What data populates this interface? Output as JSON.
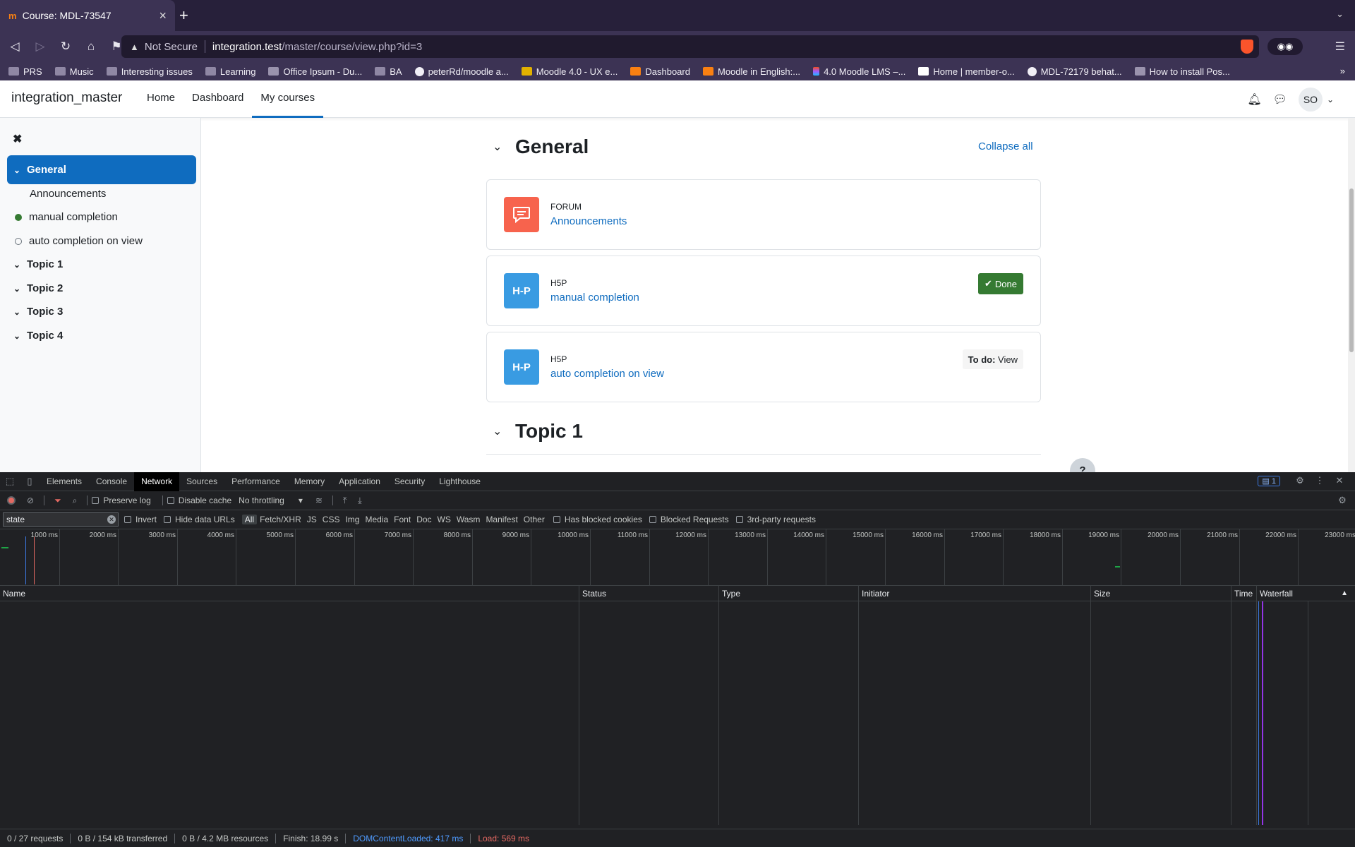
{
  "browser": {
    "tab_title": "Course: MDL-73547",
    "tab_favicon": "m",
    "url_warning": "Not Secure",
    "url_host": "integration.test",
    "url_path": "/master/course/view.php?id=3",
    "bookmarks": [
      {
        "label": "PRS",
        "icon": "folder"
      },
      {
        "label": "Music",
        "icon": "folder"
      },
      {
        "label": "Interesting issues",
        "icon": "folder"
      },
      {
        "label": "Learning",
        "icon": "folder"
      },
      {
        "label": "Office Ipsum - Du...",
        "icon": "page"
      },
      {
        "label": "BA",
        "icon": "folder"
      },
      {
        "label": "peterRd/moodle a...",
        "icon": "github"
      },
      {
        "label": "Moodle 4.0 - UX e...",
        "icon": "mustard"
      },
      {
        "label": "Dashboard",
        "icon": "moodle"
      },
      {
        "label": "Moodle in English:...",
        "icon": "moodle"
      },
      {
        "label": "4.0 Moodle LMS –...",
        "icon": "figma"
      },
      {
        "label": "Home | member-o...",
        "icon": "wix"
      },
      {
        "label": "MDL-72179 behat...",
        "icon": "github"
      },
      {
        "label": "How to install Pos...",
        "icon": "page"
      }
    ],
    "bookmarks_more": "»"
  },
  "moodle": {
    "site_name": "integration_master",
    "primary_nav": [
      {
        "label": "Home",
        "active": false
      },
      {
        "label": "Dashboard",
        "active": false
      },
      {
        "label": "My courses",
        "active": true
      }
    ],
    "user_initials": "SO",
    "course_index": [
      {
        "label": "General",
        "kind": "section",
        "active": true
      },
      {
        "label": "Announcements",
        "kind": "activity-plain"
      },
      {
        "label": "manual completion",
        "kind": "activity-done"
      },
      {
        "label": "auto completion on view",
        "kind": "activity-todo"
      },
      {
        "label": "Topic 1",
        "kind": "section"
      },
      {
        "label": "Topic 2",
        "kind": "section"
      },
      {
        "label": "Topic 3",
        "kind": "section"
      },
      {
        "label": "Topic 4",
        "kind": "section"
      }
    ],
    "section_general_title": "General",
    "collapse_all": "Collapse all",
    "activities": [
      {
        "type": "FORUM",
        "name": "Announcements",
        "icon": "forum-icon",
        "icon_color": "#f7634d"
      },
      {
        "type": "H5P",
        "name": "manual completion",
        "icon": "h5p-icon",
        "icon_color": "#399be2",
        "completion": "Done"
      },
      {
        "type": "H5P",
        "name": "auto completion on view",
        "icon": "h5p-icon",
        "icon_color": "#399be2",
        "todo_prefix": "To do:",
        "todo_value": "View"
      }
    ],
    "h5p_icon_text": "H-P",
    "section_topic1_title": "Topic 1",
    "help_label": "?"
  },
  "devtools": {
    "tabs": [
      "Elements",
      "Console",
      "Network",
      "Sources",
      "Performance",
      "Memory",
      "Application",
      "Security",
      "Lighthouse"
    ],
    "active_tab": "Network",
    "issues_count": "1",
    "toolbar": {
      "preserve_log": "Preserve log",
      "disable_cache": "Disable cache",
      "throttling": "No throttling"
    },
    "filter": {
      "value": "state",
      "invert": "Invert",
      "hide_data_urls": "Hide data URLs",
      "types": [
        "All",
        "Fetch/XHR",
        "JS",
        "CSS",
        "Img",
        "Media",
        "Font",
        "Doc",
        "WS",
        "Wasm",
        "Manifest",
        "Other"
      ],
      "active_type": "All",
      "has_blocked_cookies": "Has blocked cookies",
      "blocked_requests": "Blocked Requests",
      "third_party": "3rd-party requests"
    },
    "timeline_ticks": [
      "1000 ms",
      "2000 ms",
      "3000 ms",
      "4000 ms",
      "5000 ms",
      "6000 ms",
      "7000 ms",
      "8000 ms",
      "9000 ms",
      "10000 ms",
      "11000 ms",
      "12000 ms",
      "13000 ms",
      "14000 ms",
      "15000 ms",
      "16000 ms",
      "17000 ms",
      "18000 ms",
      "19000 ms",
      "20000 ms",
      "21000 ms",
      "22000 ms",
      "23000 ms"
    ],
    "columns": [
      "Name",
      "Status",
      "Type",
      "Initiator",
      "Size",
      "Time",
      "Waterfall"
    ],
    "status": {
      "requests": "0 / 27 requests",
      "transferred": "0 B / 154 kB transferred",
      "resources": "0 B / 4.2 MB resources",
      "finish": "Finish: 18.99 s",
      "dom_loaded": "DOMContentLoaded: 417 ms",
      "load": "Load: 569 ms"
    }
  }
}
